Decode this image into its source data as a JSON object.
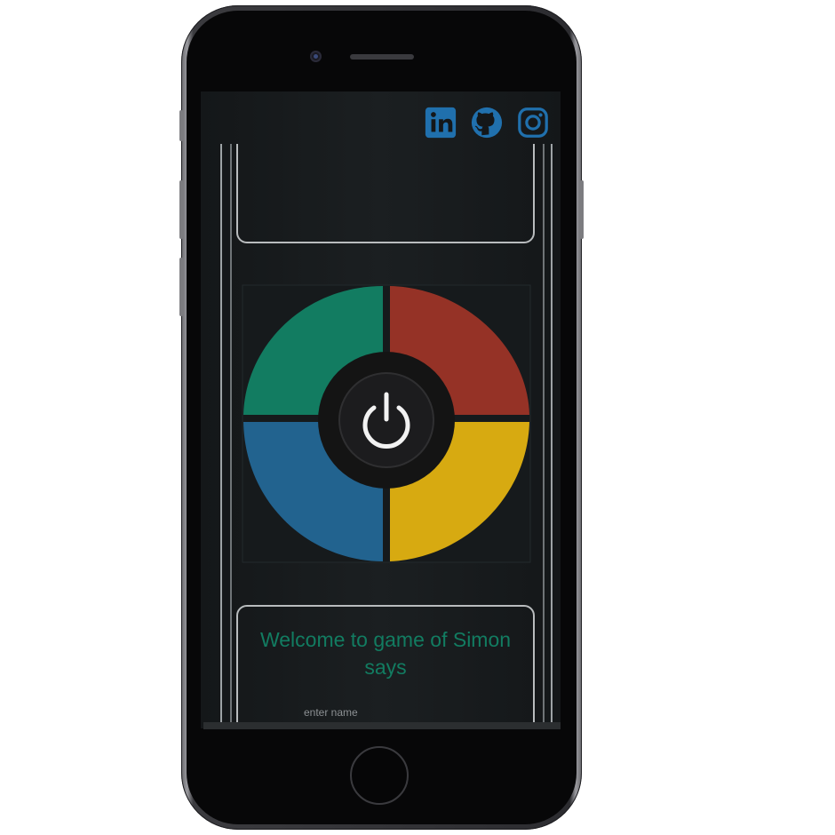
{
  "colors": {
    "green_quadrant": "#127c61",
    "red_quadrant": "#953226",
    "blue_quadrant": "#22638f",
    "yellow_quadrant": "#d7aa11",
    "hub": "#141414",
    "power_icon": "#f2f2f2",
    "social_icon": "#2070ad",
    "welcome_text": "#127c61"
  },
  "socials": [
    {
      "name": "linkedin-icon"
    },
    {
      "name": "github-icon"
    },
    {
      "name": "instagram-icon"
    }
  ],
  "game": {
    "power_icon": "power-icon"
  },
  "welcome": {
    "title": "Welcome to game of Simon says",
    "name_label": "enter name"
  }
}
